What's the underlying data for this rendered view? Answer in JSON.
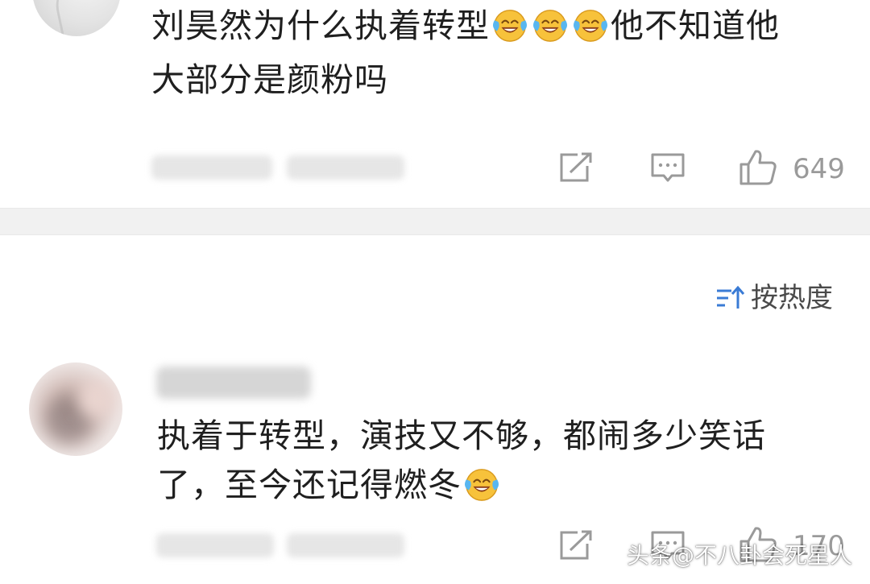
{
  "comment1": {
    "text_line1_a": "刘昊然为什么执着转型",
    "text_line1_b": "他不知道他",
    "text_line2": "大部分是颜粉吗",
    "emoji": [
      "laugh-cry-emoji",
      "laugh-cry-emoji",
      "laugh-cry-emoji"
    ],
    "like_count": "649"
  },
  "sort": {
    "label": "按热度"
  },
  "comment2": {
    "text_line1": "执着于转型，演技又不够，都闹多少笑话",
    "text_line2": "了，至今还记得燃冬",
    "emoji": [
      "laugh-cry-emoji"
    ],
    "like_count": "170"
  },
  "watermark": "头条@不八卦会死星人",
  "colors": {
    "background": "#ffffff",
    "divider": "#f1f1f1",
    "icon_gray": "#9a9a9a",
    "emoji_yellow": "#f7c23b"
  }
}
